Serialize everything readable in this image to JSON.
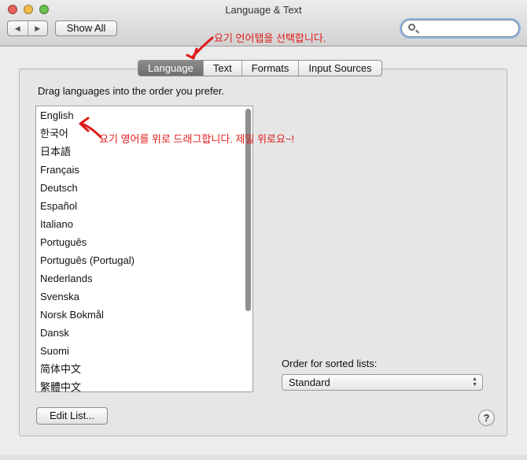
{
  "window": {
    "title": "Language & Text",
    "nav_back": "◀",
    "nav_forward": "▶",
    "show_all_label": "Show All",
    "search_value": ""
  },
  "tabs": [
    {
      "label": "Language",
      "active": true
    },
    {
      "label": "Text",
      "active": false
    },
    {
      "label": "Formats",
      "active": false
    },
    {
      "label": "Input Sources",
      "active": false
    }
  ],
  "language_panel": {
    "instruction": "Drag languages into the order you prefer.",
    "languages": [
      "English",
      "한국어",
      "日本語",
      "Français",
      "Deutsch",
      "Español",
      "Italiano",
      "Português",
      "Português (Portugal)",
      "Nederlands",
      "Svenska",
      "Norsk Bokmål",
      "Dansk",
      "Suomi",
      "简体中文",
      "繁體中文"
    ],
    "order_label": "Order for sorted lists:",
    "order_value": "Standard",
    "edit_list_label": "Edit List...",
    "help_label": "?"
  },
  "annotations": {
    "tab_note": "요기 언어탭을 선택합니다.",
    "drag_note": "요기 영어를 위로 드래그합니다. 제일 위로요~!",
    "color": "#e01a1a"
  }
}
